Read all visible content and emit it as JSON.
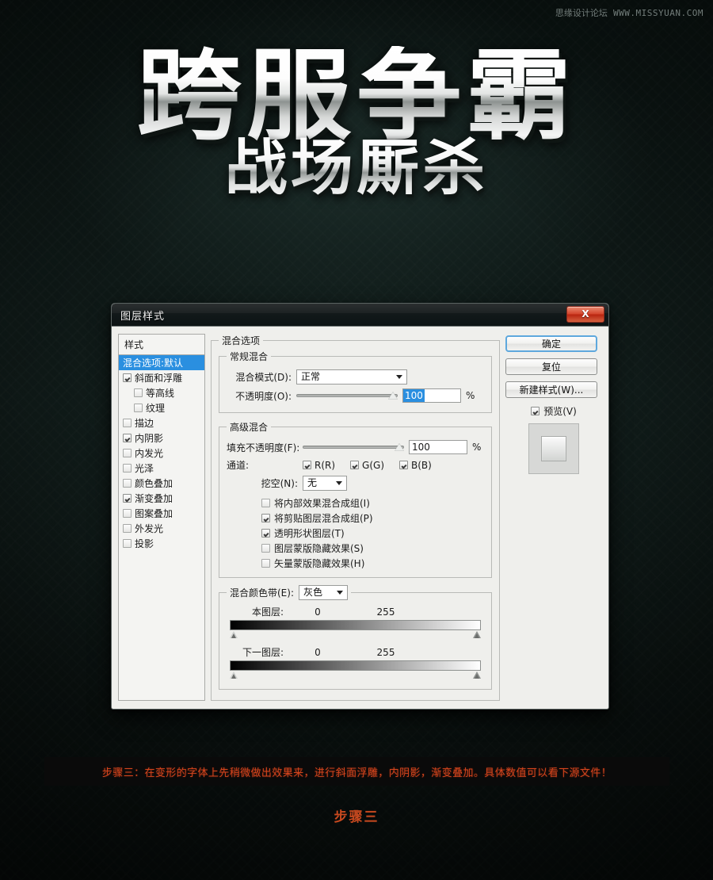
{
  "watermark": {
    "site_cn": "思缘设计论坛",
    "site_url": "WWW.MISSYUAN.COM"
  },
  "hero": {
    "main_title": "跨服争霸",
    "sub_title": "战场厮杀"
  },
  "dialog": {
    "title": "图层样式",
    "close_label": "X",
    "styles": {
      "header": "样式",
      "items": [
        {
          "label": "混合选项:默认",
          "checkbox": "none",
          "selected": true,
          "indent": false
        },
        {
          "label": "斜面和浮雕",
          "checkbox": "checked",
          "selected": false,
          "indent": false
        },
        {
          "label": "等高线",
          "checkbox": "unchecked",
          "selected": false,
          "indent": true
        },
        {
          "label": "纹理",
          "checkbox": "unchecked",
          "selected": false,
          "indent": true
        },
        {
          "label": "描边",
          "checkbox": "unchecked",
          "selected": false,
          "indent": false
        },
        {
          "label": "内阴影",
          "checkbox": "checked",
          "selected": false,
          "indent": false
        },
        {
          "label": "内发光",
          "checkbox": "unchecked",
          "selected": false,
          "indent": false
        },
        {
          "label": "光泽",
          "checkbox": "unchecked",
          "selected": false,
          "indent": false
        },
        {
          "label": "颜色叠加",
          "checkbox": "unchecked",
          "selected": false,
          "indent": false
        },
        {
          "label": "渐变叠加",
          "checkbox": "checked",
          "selected": false,
          "indent": false
        },
        {
          "label": "图案叠加",
          "checkbox": "unchecked",
          "selected": false,
          "indent": false
        },
        {
          "label": "外发光",
          "checkbox": "unchecked",
          "selected": false,
          "indent": false
        },
        {
          "label": "投影",
          "checkbox": "unchecked",
          "selected": false,
          "indent": false
        }
      ]
    },
    "blending_options": {
      "legend": "混合选项",
      "general": {
        "legend": "常规混合",
        "blend_mode_label": "混合模式(D):",
        "blend_mode_value": "正常",
        "opacity_label": "不透明度(O):",
        "opacity_value": "100",
        "opacity_unit": "%"
      },
      "advanced": {
        "legend": "高级混合",
        "fill_opacity_label": "填充不透明度(F):",
        "fill_opacity_value": "100",
        "fill_opacity_unit": "%",
        "channels_label": "通道:",
        "channels": [
          {
            "label": "R(R)",
            "checked": true
          },
          {
            "label": "G(G)",
            "checked": true
          },
          {
            "label": "B(B)",
            "checked": true
          }
        ],
        "knockout_label": "挖空(N):",
        "knockout_value": "无",
        "checkboxes": [
          {
            "label": "将内部效果混合成组(I)",
            "checked": false
          },
          {
            "label": "将剪贴图层混合成组(P)",
            "checked": true
          },
          {
            "label": "透明形状图层(T)",
            "checked": true
          },
          {
            "label": "图层蒙版隐藏效果(S)",
            "checked": false
          },
          {
            "label": "矢量蒙版隐藏效果(H)",
            "checked": false
          }
        ]
      },
      "blend_if": {
        "legend_label": "混合颜色带(E):",
        "channel_value": "灰色",
        "rows": [
          {
            "name": "本图层:",
            "min": "0",
            "max": "255"
          },
          {
            "name": "下一图层:",
            "min": "0",
            "max": "255"
          }
        ]
      }
    },
    "buttons": {
      "ok": "确定",
      "reset": "复位",
      "new_style": "新建样式(W)...",
      "preview_label": "预览(V)",
      "preview_checked": true
    }
  },
  "caption": {
    "text": "步骤三：在变形的字体上先稍微做出效果来，进行斜面浮雕，内阴影，渐变叠加。具体数值可以看下源文件！",
    "step_label": "步骤三"
  },
  "colors": {
    "page_bg": "#0c1513",
    "accent_blue": "#2a8fe0",
    "caption_red": "#d4451d",
    "step_orange": "#c8491f",
    "dialog_bg": "#efefec"
  }
}
